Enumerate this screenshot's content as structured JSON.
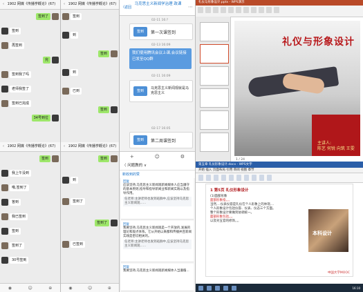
{
  "chat_left": {
    "header_top": "1902 网媒《传播学概论》(67)",
    "header_bottom": "1902 网媒《传播学概论》(67)",
    "messages_top": [
      {
        "side": "me",
        "text": "签到了"
      },
      {
        "side": "them",
        "text": "签到"
      },
      {
        "side": "them",
        "text": "再签到"
      },
      {
        "side": "me",
        "text": "完"
      },
      {
        "side": "them",
        "text": "签到我了吗"
      },
      {
        "side": "them",
        "text": "老师我签了"
      },
      {
        "side": "them",
        "text": "签到已完成"
      },
      {
        "side": "me",
        "text": "34号到位"
      }
    ],
    "messages_bottom": [
      {
        "side": "me",
        "text": "签到"
      },
      {
        "side": "them",
        "text": "我上午没到"
      },
      {
        "side": "them",
        "text": "哦,签到了"
      },
      {
        "side": "them",
        "text": "答到"
      },
      {
        "side": "them",
        "text": "我已签到"
      },
      {
        "side": "them",
        "text": "签到"
      },
      {
        "side": "them",
        "text": "签到了"
      },
      {
        "side": "them",
        "text": "30号签到"
      }
    ]
  },
  "chat_right": {
    "header_top": "1902 网媒《传播学概论》(67)",
    "header_bottom": "1902 网媒《传播学概论》(67)",
    "messages_top": [
      {
        "side": "them",
        "text": "签到"
      },
      {
        "side": "them",
        "text": "到"
      },
      {
        "side": "me",
        "text": "签到"
      },
      {
        "side": "them",
        "text": "到"
      },
      {
        "side": "them",
        "text": "已到"
      },
      {
        "side": "me",
        "text": "签到"
      }
    ],
    "messages_bottom": [
      {
        "side": "me",
        "text": "签到"
      },
      {
        "side": "them",
        "text": "到"
      },
      {
        "side": "them",
        "text": "签到了"
      },
      {
        "side": "me",
        "text": "签到了"
      },
      {
        "side": "them",
        "text": "已签到"
      }
    ]
  },
  "course": {
    "back_label": "〈返回",
    "title": "马克思主义新闻学治理 政课",
    "cards": [
      {
        "badge": "签到",
        "title": "第一次课签到",
        "time": "02-11 16:?"
      },
      {
        "badge": "签到",
        "title": "马克思主义新闻观就是马克思主义",
        "time": "02-11 16:09"
      },
      {
        "badge": "签到",
        "title": "第二周课签到",
        "time": "02-17 16:05"
      }
    ],
    "note": "我们使用腾讯会议上课,会议链接已发至QQ群",
    "note_time": "02-13 16:09",
    "bottom_icons": [
      "+",
      "☺",
      "⚙"
    ]
  },
  "discussion": {
    "header": "〈 问题教的 ∨",
    "subheader": "新收到的赞",
    "posts": [
      {
        "name": "回复",
        "text": "应该坚持,马克思主义新闻观新闻媒体人应当遵守的基本原则,指导和指导新闻业和新闻实践以及指导作用。",
        "reply": "任老师:主讲老师也发到班群中,应该坚持马克思主义新闻观......"
      },
      {
        "name": "回复",
        "text": "我要坚持,马克思主义新闻观是一个开放的,发展的理论和观点体系。它从开始以来都和传播并且新闻实践是密切相关的。",
        "reply": "任老师:主讲老师也发到班群中,应该坚持马克思主义新闻观......"
      },
      {
        "name": "回复",
        "text": "我要坚持,马克思主义新闻观新闻媒体人当遵循..."
      }
    ]
  },
  "ppt": {
    "title_bar": "礼仪与形象设计.pptx - WPS演示",
    "slide_title": "礼仪与形象设计",
    "presenter_label": "主讲人:",
    "presenter_names": "陈艺 何锐 向筑 王雯",
    "page_indicator": "1 / 24"
  },
  "word": {
    "title_bar": "第五章 礼仪形象设计.docx - WPS文字",
    "tabs": "开始 插入 页面布局 引用 审阅 视图 章节",
    "heading": "1 第5页 礼仪形象设计",
    "paragraphs": [
      {
        "style": "normal",
        "text": "(1)面部形象"
      },
      {
        "style": "red",
        "text": "面部形象指,,,,"
      },
      {
        "style": "normal",
        "text": "当然,...仪表仪容是礼仪在个人形象上的体现,..."
      },
      {
        "style": "normal",
        "text": "个人形象设计包括仪容、仪表、仪态三个方面。"
      },
      {
        "style": "normal",
        "text": "整个形象设计要做到协调统一。"
      },
      {
        "style": "red",
        "text": "面部形象包括,,,,"
      },
      {
        "style": "normal",
        "text": "以及对五官的修饰,,,,"
      }
    ],
    "image_caption": "本科设计",
    "watermark": "中国大学MOOC",
    "clock": "16:10"
  }
}
